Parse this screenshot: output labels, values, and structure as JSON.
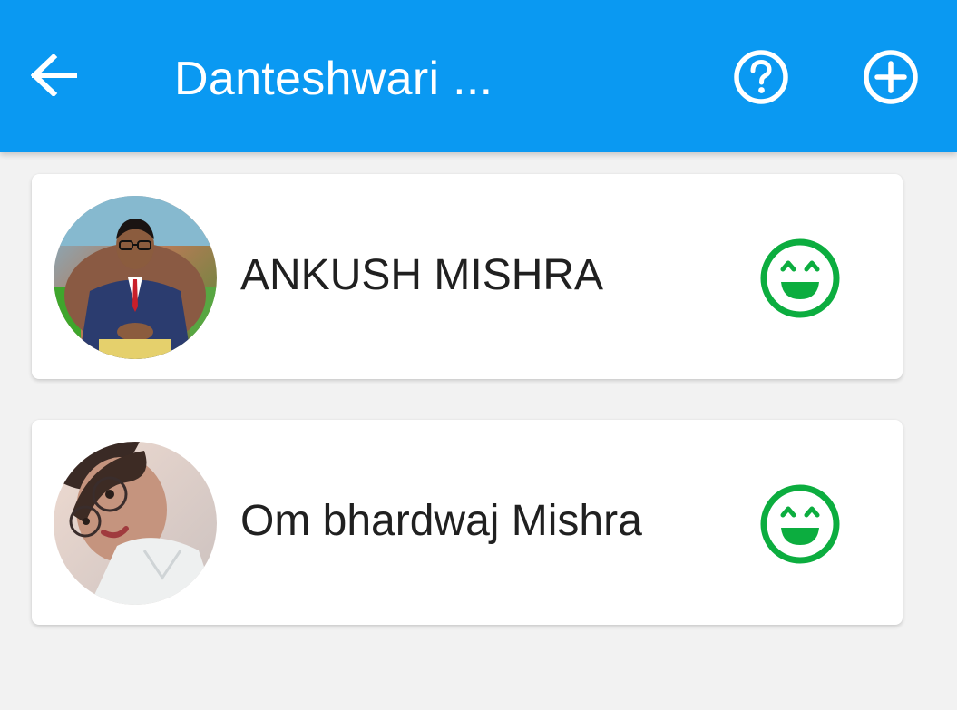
{
  "app_bar": {
    "title": "Danteshwari ...",
    "back_icon": "arrow-left-icon",
    "help_icon": "help-circle-icon",
    "add_icon": "add-circle-icon",
    "background_color": "#0a99f2"
  },
  "members": [
    {
      "name": "ANKUSH MISHRA",
      "avatar": "avatar-photo",
      "status_icon": "happy-face-icon",
      "status_color": "#0cad3f"
    },
    {
      "name": "Om bhardwaj Mishra",
      "avatar": "avatar-photo",
      "status_icon": "happy-face-icon",
      "status_color": "#0cad3f"
    }
  ]
}
